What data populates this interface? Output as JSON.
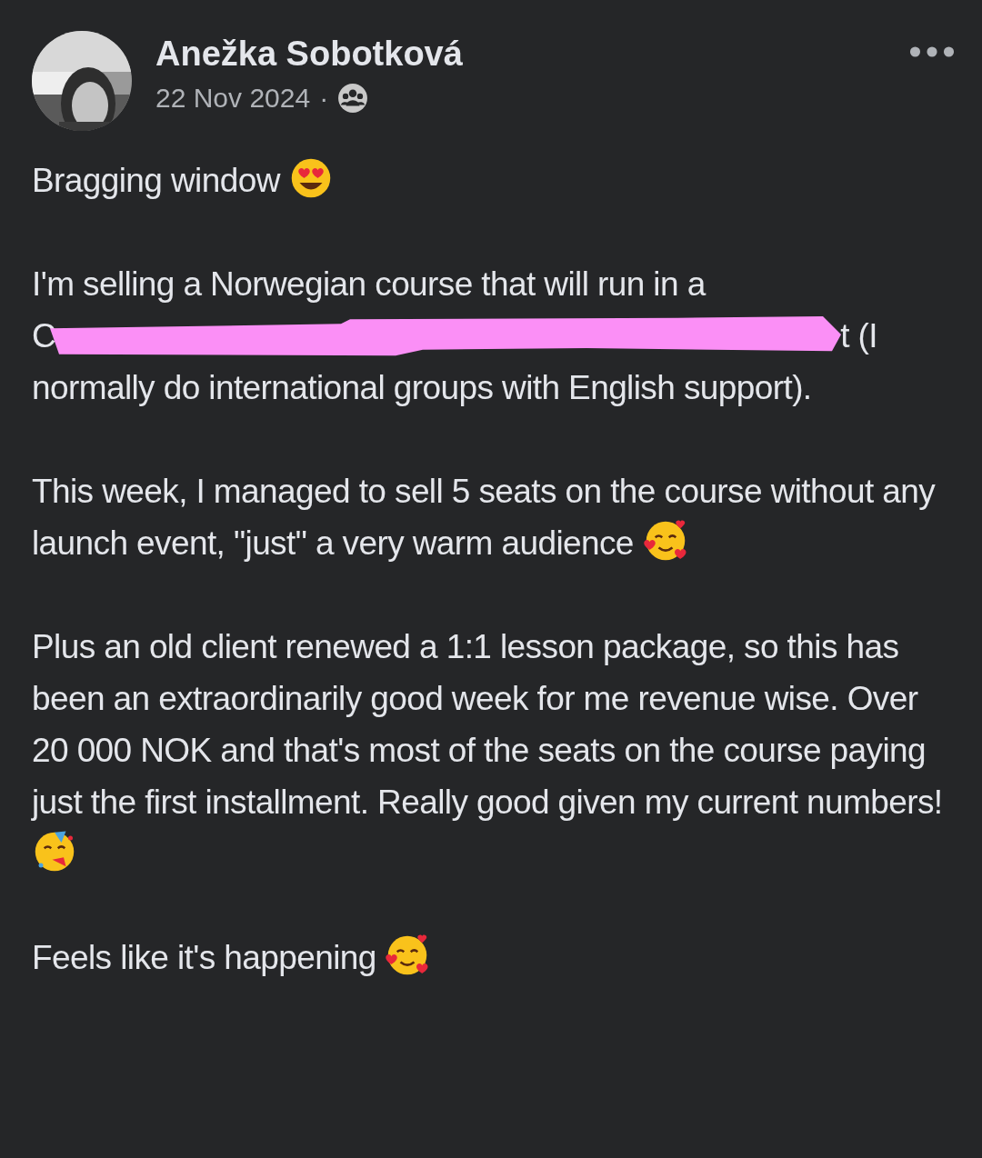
{
  "post": {
    "author": "Anežka Sobotková",
    "date": "22 Nov 2024",
    "separator": "·",
    "paragraphs": [
      {
        "kind": "text",
        "text": "Bragging window",
        "emoji": {
          "kind": "heart_eyes"
        }
      },
      {
        "kind": "redacted",
        "before": "I'm selling a Norwegian course that will run in a",
        "fragment_start": "C",
        "fragment_end": "t (I",
        "after": "normally do international groups with English support)."
      },
      {
        "kind": "text",
        "text": "This week, I managed to sell 5 seats on the course without any launch event, \"just\" a very warm audience",
        "emoji": {
          "kind": "hearts"
        }
      },
      {
        "kind": "text",
        "text": "Plus an old client renewed a 1:1 lesson package, so this has been an extraordinarily good week for me revenue wise. Over 20 000 NOK and that's most of the seats on the course paying just the first installment. Really good given my current numbers!",
        "emoji": {
          "kind": "party"
        }
      },
      {
        "kind": "text",
        "text": "Feels like it's happening",
        "emoji": {
          "kind": "hearts"
        }
      }
    ]
  }
}
